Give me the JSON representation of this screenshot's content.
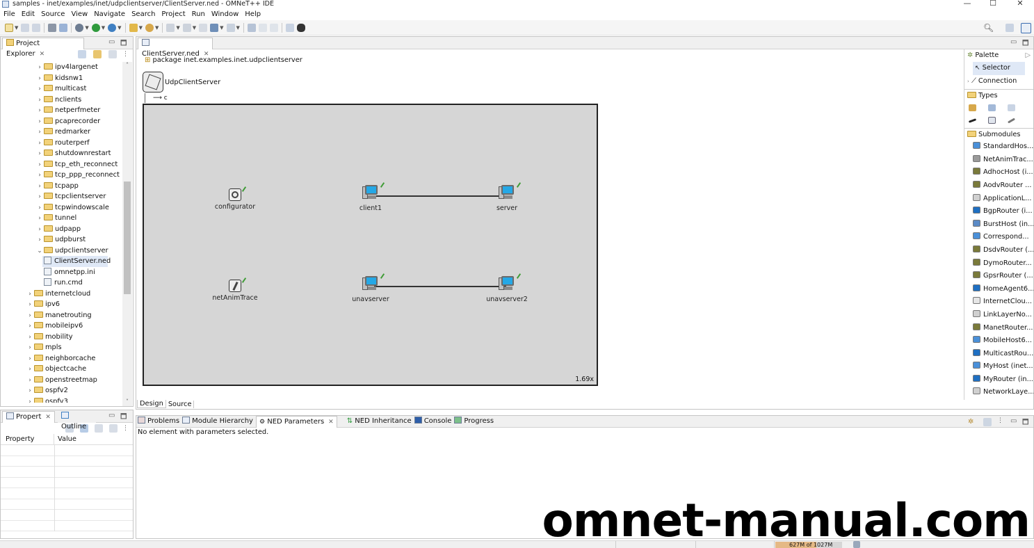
{
  "window": {
    "title": "samples - inet/examples/inet/udpclientserver/ClientServer.ned - OMNeT++ IDE",
    "controls": [
      "—",
      "☐",
      "✕"
    ]
  },
  "menu": [
    "File",
    "Edit",
    "Source",
    "View",
    "Navigate",
    "Search",
    "Project",
    "Run",
    "Window",
    "Help"
  ],
  "explorer": {
    "title": "Project Explorer",
    "items": [
      {
        "label": "ipv4largenet",
        "level": 2,
        "type": "folder"
      },
      {
        "label": "kidsnw1",
        "level": 2,
        "type": "folder"
      },
      {
        "label": "multicast",
        "level": 2,
        "type": "folder"
      },
      {
        "label": "nclients",
        "level": 2,
        "type": "folder"
      },
      {
        "label": "netperfmeter",
        "level": 2,
        "type": "folder"
      },
      {
        "label": "pcaprecorder",
        "level": 2,
        "type": "folder"
      },
      {
        "label": "redmarker",
        "level": 2,
        "type": "folder"
      },
      {
        "label": "routerperf",
        "level": 2,
        "type": "folder"
      },
      {
        "label": "shutdownrestart",
        "level": 2,
        "type": "folder"
      },
      {
        "label": "tcp_eth_reconnect",
        "level": 2,
        "type": "folder"
      },
      {
        "label": "tcp_ppp_reconnect",
        "level": 2,
        "type": "folder"
      },
      {
        "label": "tcpapp",
        "level": 2,
        "type": "folder"
      },
      {
        "label": "tcpclientserver",
        "level": 2,
        "type": "folder"
      },
      {
        "label": "tcpwindowscale",
        "level": 2,
        "type": "folder"
      },
      {
        "label": "tunnel",
        "level": 2,
        "type": "folder"
      },
      {
        "label": "udpapp",
        "level": 2,
        "type": "folder"
      },
      {
        "label": "udpburst",
        "level": 2,
        "type": "folder"
      },
      {
        "label": "udpclientserver",
        "level": 2,
        "type": "folder",
        "expanded": true
      },
      {
        "label": "ClientServer.ned",
        "level": 3,
        "type": "file",
        "selected": true
      },
      {
        "label": "omnetpp.ini",
        "level": 3,
        "type": "file"
      },
      {
        "label": "run.cmd",
        "level": 3,
        "type": "file"
      },
      {
        "label": "internetcloud",
        "level": 1,
        "type": "folder"
      },
      {
        "label": "ipv6",
        "level": 1,
        "type": "folder"
      },
      {
        "label": "manetrouting",
        "level": 1,
        "type": "folder"
      },
      {
        "label": "mobileipv6",
        "level": 1,
        "type": "folder"
      },
      {
        "label": "mobility",
        "level": 1,
        "type": "folder"
      },
      {
        "label": "mpls",
        "level": 1,
        "type": "folder"
      },
      {
        "label": "neighborcache",
        "level": 1,
        "type": "folder"
      },
      {
        "label": "objectcache",
        "level": 1,
        "type": "folder"
      },
      {
        "label": "openstreetmap",
        "level": 1,
        "type": "folder"
      },
      {
        "label": "ospfv2",
        "level": 1,
        "type": "folder"
      },
      {
        "label": "ospfv3",
        "level": 1,
        "type": "folder"
      }
    ]
  },
  "properties": {
    "tab1": "Propert",
    "tab2": "Outline",
    "col_property": "Property",
    "col_value": "Value"
  },
  "editor": {
    "tab": "ClientServer.ned",
    "package": "package inet.examples.inet.udpclientserver",
    "network": "UdpClientServer",
    "zoom": "1.69x",
    "bottom_tabs": [
      "Design",
      "Source"
    ],
    "nodes": {
      "configurator": "configurator",
      "client1": "client1",
      "server": "server",
      "netAnimTrace": "netAnimTrace",
      "unavserver": "unavserver",
      "unavserver2": "unavserver2"
    }
  },
  "palette": {
    "title": "Palette",
    "selector": "Selector",
    "connection": "Connection",
    "types": "Types",
    "submodules": "Submodules",
    "items": [
      {
        "label": "StandardHos...",
        "color": "#4a90d9"
      },
      {
        "label": "NetAnimTrac...",
        "color": "#9a9a9a"
      },
      {
        "label": "AdhocHost (i...",
        "color": "#7a7a3a"
      },
      {
        "label": "AodvRouter ...",
        "color": "#7a7a3a"
      },
      {
        "label": "ApplicationL...",
        "color": "#d0d0d0"
      },
      {
        "label": "BgpRouter (i...",
        "color": "#1f6fc2"
      },
      {
        "label": "BurstHost (in...",
        "color": "#5a8ac6"
      },
      {
        "label": "Correspond...",
        "color": "#4a90d9"
      },
      {
        "label": "DsdvRouter (...",
        "color": "#7a7a3a"
      },
      {
        "label": "DymoRouter...",
        "color": "#7a7a3a"
      },
      {
        "label": "GpsrRouter (...",
        "color": "#7a7a3a"
      },
      {
        "label": "HomeAgent6...",
        "color": "#1f6fc2"
      },
      {
        "label": "InternetClou...",
        "color": "#e6e6e6"
      },
      {
        "label": "LinkLayerNo...",
        "color": "#d0d0d0"
      },
      {
        "label": "ManetRouter...",
        "color": "#7a7a3a"
      },
      {
        "label": "MobileHost6...",
        "color": "#4a90d9"
      },
      {
        "label": "MulticastRou...",
        "color": "#1f6fc2"
      },
      {
        "label": "MyHost (inet...",
        "color": "#4a90d9"
      },
      {
        "label": "MyRouter (in...",
        "color": "#1f6fc2"
      },
      {
        "label": "NetworkLaye...",
        "color": "#d0d0d0"
      }
    ]
  },
  "bottom": {
    "tabs": [
      "Problems",
      "Module Hierarchy",
      "NED Parameters",
      "NED Inheritance",
      "Console",
      "Progress"
    ],
    "message": "No element with parameters selected."
  },
  "status": {
    "memory": "627M of 1027M"
  },
  "watermark": "omnet-manual.com"
}
